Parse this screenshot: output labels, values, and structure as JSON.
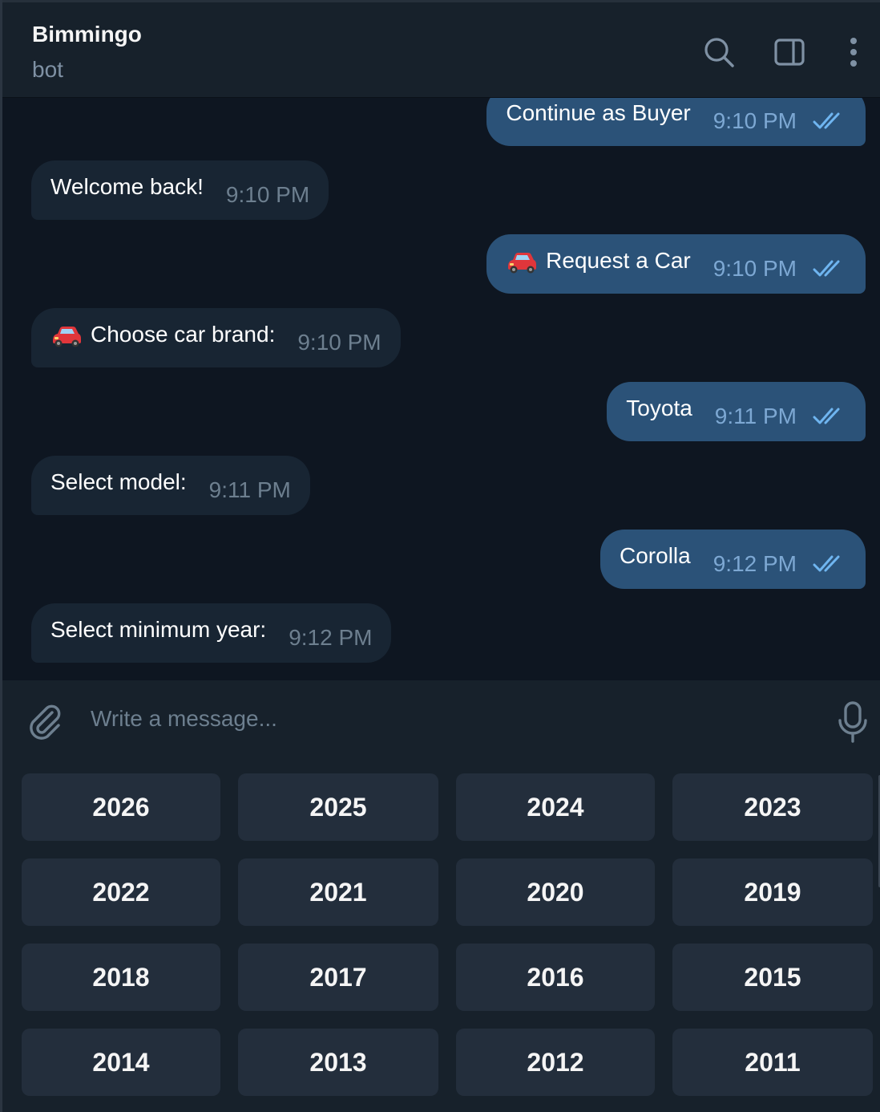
{
  "header": {
    "title": "Bimmingo",
    "subtitle": "bot"
  },
  "messages": [
    {
      "dir": "out",
      "text": "Continue as Buyer",
      "time": "9:10 PM",
      "read": true
    },
    {
      "dir": "in",
      "text": "Welcome back!",
      "time": "9:10 PM"
    },
    {
      "dir": "out",
      "emoji": "car",
      "text": "Request a Car",
      "time": "9:10 PM",
      "read": true
    },
    {
      "dir": "in",
      "emoji": "car",
      "text": "Choose car brand:",
      "time": "9:10 PM"
    },
    {
      "dir": "out",
      "text": "Toyota",
      "time": "9:11 PM",
      "read": true
    },
    {
      "dir": "in",
      "text": "Select model:",
      "time": "9:11 PM"
    },
    {
      "dir": "out",
      "text": "Corolla",
      "time": "9:12 PM",
      "read": true
    },
    {
      "dir": "in",
      "text": "Select minimum year:",
      "time": "9:12 PM"
    }
  ],
  "composer": {
    "placeholder": "Write a message..."
  },
  "keyboard": {
    "rows": [
      [
        "2026",
        "2025",
        "2024",
        "2023"
      ],
      [
        "2022",
        "2021",
        "2020",
        "2019"
      ],
      [
        "2018",
        "2017",
        "2016",
        "2015"
      ],
      [
        "2014",
        "2013",
        "2012",
        "2011"
      ]
    ]
  },
  "colors": {
    "background": "#0e1621",
    "header": "#17212b",
    "incoming_bubble": "#182533",
    "outgoing_bubble": "#2b5278",
    "keyboard_button": "#232e3c",
    "read_check": "#6fb5f0"
  },
  "icons": [
    "search-icon",
    "sidebar-toggle-icon",
    "more-vertical-icon",
    "paperclip-icon",
    "microphone-icon",
    "double-check-icon",
    "car-emoji"
  ]
}
